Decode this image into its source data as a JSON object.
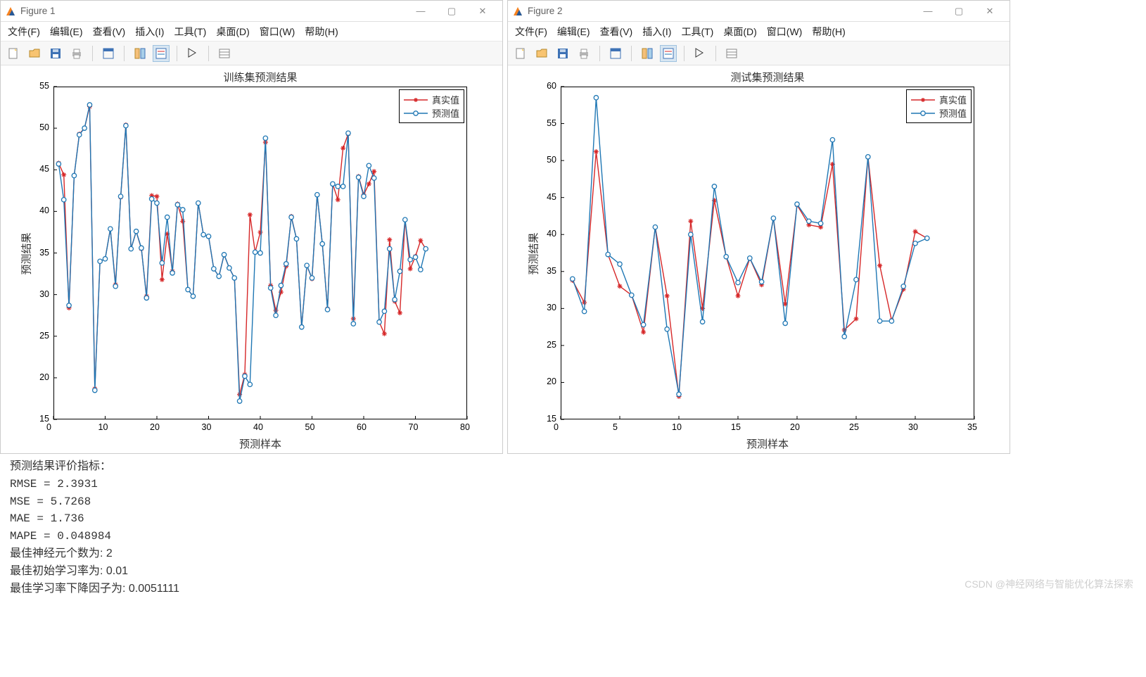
{
  "fig1": {
    "title": "Figure 1"
  },
  "fig2": {
    "title": "Figure 2"
  },
  "winctrls": {
    "min": "—",
    "max": "▢",
    "close": "✕"
  },
  "menu": [
    "文件(F)",
    "编辑(E)",
    "查看(V)",
    "插入(I)",
    "工具(T)",
    "桌面(D)",
    "窗口(W)",
    "帮助(H)"
  ],
  "legend": {
    "actual": "真实值",
    "pred": "预测值"
  },
  "chart_data": [
    {
      "type": "line",
      "title": "训练集预测结果",
      "xlabel": "预测样本",
      "ylabel": "预测结果",
      "xlim": [
        0,
        80
      ],
      "xticks": [
        0,
        10,
        20,
        30,
        40,
        50,
        60,
        70,
        80
      ],
      "ylim": [
        15,
        55
      ],
      "yticks": [
        15,
        20,
        25,
        30,
        35,
        40,
        45,
        50,
        55
      ],
      "x": [
        1,
        2,
        3,
        4,
        5,
        6,
        7,
        8,
        9,
        10,
        11,
        12,
        13,
        14,
        15,
        16,
        17,
        18,
        19,
        20,
        21,
        22,
        23,
        24,
        25,
        26,
        27,
        28,
        29,
        30,
        31,
        32,
        33,
        34,
        35,
        36,
        37,
        38,
        39,
        40,
        41,
        42,
        43,
        44,
        45,
        46,
        47,
        48,
        49,
        50,
        51,
        52,
        53,
        54,
        55,
        56,
        57,
        58,
        59,
        60,
        61,
        62,
        63,
        64,
        65,
        66,
        67,
        68,
        69,
        70,
        71,
        72
      ],
      "series": [
        {
          "name": "真实值",
          "color": "#d62728",
          "marker": "*",
          "values": [
            45.8,
            44.4,
            28.4,
            44.3,
            49.3,
            50.0,
            52.6,
            18.7,
            34.0,
            34.3,
            37.9,
            31.2,
            41.7,
            50.4,
            35.5,
            37.6,
            35.5,
            29.8,
            41.9,
            41.8,
            31.8,
            37.3,
            32.8,
            40.9,
            38.8,
            30.6,
            29.8,
            41.0,
            37.2,
            37.0,
            33.1,
            32.2,
            34.8,
            33.2,
            32.0,
            18.0,
            20.4,
            39.6,
            35.1,
            37.5,
            48.3,
            31.1,
            28.1,
            30.3,
            33.4,
            39.4,
            36.7,
            26.1,
            33.5,
            31.9,
            42.0,
            36.1,
            28.3,
            43.3,
            41.4,
            47.6,
            49.3,
            27.1,
            44.2,
            42.0,
            43.3,
            44.8,
            26.7,
            25.3,
            36.6,
            29.2,
            27.8,
            39.0,
            33.1,
            34.6,
            36.5,
            35.5
          ]
        },
        {
          "name": "预测值",
          "color": "#1f77b4",
          "marker": "o",
          "values": [
            45.7,
            41.4,
            28.7,
            44.3,
            49.2,
            50.0,
            52.8,
            18.5,
            34.0,
            34.3,
            37.9,
            31.0,
            41.8,
            50.3,
            35.5,
            37.6,
            35.6,
            29.6,
            41.5,
            41.0,
            33.8,
            39.3,
            32.6,
            40.8,
            40.2,
            30.6,
            29.8,
            41.0,
            37.2,
            37.0,
            33.1,
            32.2,
            34.8,
            33.2,
            32.0,
            17.2,
            20.2,
            19.2,
            35.1,
            35.0,
            48.8,
            30.8,
            27.5,
            31.1,
            33.7,
            39.3,
            36.7,
            26.1,
            33.5,
            32.0,
            42.0,
            36.1,
            28.2,
            43.3,
            43.0,
            43.0,
            49.4,
            26.5,
            44.1,
            41.8,
            45.5,
            44.0,
            26.7,
            28.0,
            35.5,
            29.4,
            32.8,
            39.0,
            34.2,
            34.5,
            33.0,
            35.5
          ]
        }
      ]
    },
    {
      "type": "line",
      "title": "测试集预测结果",
      "xlabel": "预测样本",
      "ylabel": "预测结果",
      "xlim": [
        0,
        35
      ],
      "xticks": [
        0,
        5,
        10,
        15,
        20,
        25,
        30,
        35
      ],
      "ylim": [
        15,
        60
      ],
      "yticks": [
        15,
        20,
        25,
        30,
        35,
        40,
        45,
        50,
        55,
        60
      ],
      "x": [
        1,
        2,
        3,
        4,
        5,
        6,
        7,
        8,
        9,
        10,
        11,
        12,
        13,
        14,
        15,
        16,
        17,
        18,
        19,
        20,
        21,
        22,
        23,
        24,
        25,
        26,
        27,
        28,
        29,
        30,
        31
      ],
      "series": [
        {
          "name": "真实值",
          "color": "#d62728",
          "marker": "*",
          "values": [
            33.8,
            30.8,
            51.2,
            37.3,
            33.0,
            31.8,
            26.8,
            41.0,
            31.7,
            18.1,
            41.8,
            30.0,
            44.6,
            37.0,
            31.7,
            36.8,
            33.2,
            42.2,
            30.6,
            44.0,
            41.3,
            41.0,
            49.5,
            27.1,
            28.6,
            50.5,
            35.8,
            28.4,
            32.6,
            40.4,
            39.5
          ]
        },
        {
          "name": "预测值",
          "color": "#1f77b4",
          "marker": "o",
          "values": [
            34.0,
            29.6,
            58.5,
            37.3,
            36.0,
            31.8,
            27.8,
            41.0,
            27.2,
            18.4,
            40.0,
            28.2,
            46.5,
            37.0,
            33.5,
            36.8,
            33.6,
            42.2,
            28.0,
            44.1,
            41.8,
            41.5,
            52.8,
            26.2,
            33.9,
            50.5,
            28.3,
            28.3,
            33.0,
            38.8,
            39.5
          ]
        }
      ]
    }
  ],
  "console": {
    "header": "预测结果评价指标：",
    "metrics": [
      "RMSE = 2.3931",
      "MSE  = 5.7268",
      "MAE  = 1.736",
      "MAPE = 0.048984"
    ],
    "best": [
      "最佳神经元个数为: 2",
      "最佳初始学习率为: 0.01",
      "最佳学习率下降因子为: 0.0051111"
    ]
  },
  "watermark": "CSDN @神经网络与智能优化算法探索"
}
